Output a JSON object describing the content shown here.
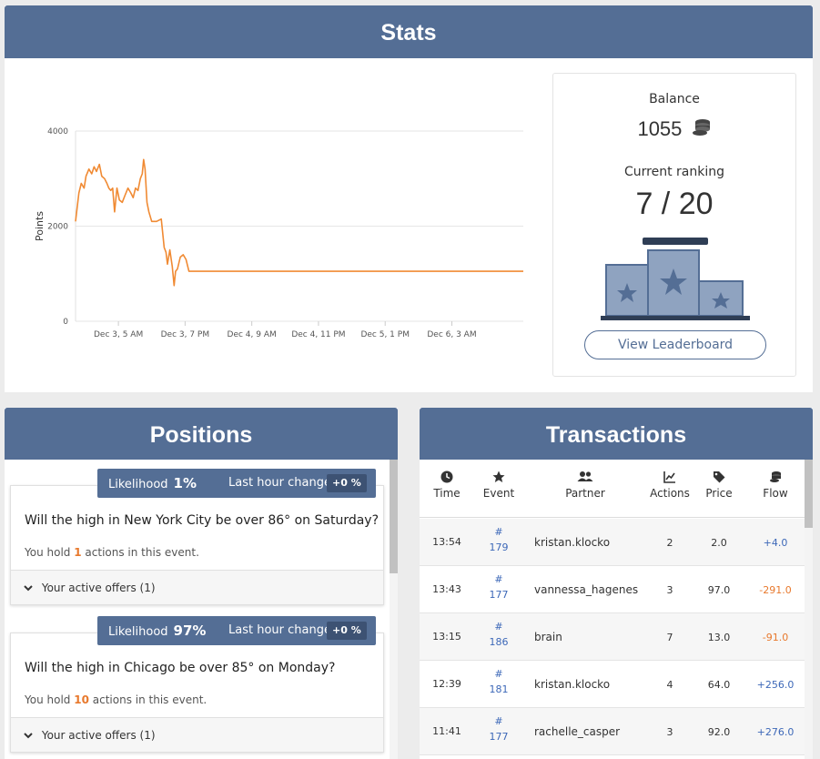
{
  "stats": {
    "title": "Stats",
    "balance_label": "Balance",
    "balance_value": "1055",
    "ranking_label": "Current ranking",
    "ranking_value": "7 / 20",
    "leaderboard_button": "View Leaderboard"
  },
  "chart_data": {
    "type": "line",
    "ylabel": "Points",
    "ylim": [
      0,
      4000
    ],
    "yticks": [
      "0",
      "2000",
      "4000"
    ],
    "xticks": [
      "Dec 3, 5 AM",
      "Dec 3, 7 PM",
      "Dec 4, 9 AM",
      "Dec 4, 11 PM",
      "Dec 5, 1 PM",
      "Dec 6, 3 AM"
    ],
    "xlim_hours": [
      -9,
      85
    ],
    "series": [
      {
        "color": "#f08a33",
        "x": [
          -9,
          -8.3,
          -7.8,
          -7.2,
          -6.8,
          -6.2,
          -5.6,
          -5.1,
          -4.6,
          -4.0,
          -3.5,
          -2.9,
          -2.4,
          -2.0,
          -1.6,
          -1.2,
          -0.8,
          -0.3,
          0.2,
          0.8,
          1.4,
          2.0,
          2.6,
          3.1,
          3.6,
          4.1,
          4.6,
          5.0,
          5.3,
          5.6,
          6.0,
          6.4,
          7.0,
          8.0,
          9.0,
          9.6,
          10.0,
          10.3,
          10.8,
          11.3,
          11.7,
          12.0,
          12.4,
          13.0,
          13.6,
          14.2,
          14.8,
          85
        ],
        "y": [
          2100,
          2700,
          2900,
          2800,
          3050,
          3200,
          3100,
          3250,
          3150,
          3300,
          3050,
          3000,
          2900,
          2800,
          2750,
          2800,
          2300,
          2800,
          2550,
          2500,
          2650,
          2800,
          2700,
          2600,
          2800,
          2750,
          3000,
          3100,
          3400,
          3200,
          2500,
          2300,
          2100,
          2100,
          2150,
          1550,
          1450,
          1200,
          1500,
          1150,
          750,
          1050,
          1100,
          1350,
          1400,
          1300,
          1050,
          1050
        ]
      }
    ]
  },
  "positions": {
    "title": "Positions",
    "likelihood_label": "Likelihood",
    "last_hour_label": "Last hour change",
    "hold_prefix": "You hold",
    "hold_suffix": "actions in this event.",
    "items": [
      {
        "likelihood": "1%",
        "change": "+0 %",
        "question": "Will the high in New York City be over 86° on Saturday?",
        "held": "1",
        "offers": "Your active offers (1)"
      },
      {
        "likelihood": "97%",
        "change": "+0 %",
        "question": "Will the high in Chicago be over 85° on Monday?",
        "held": "10",
        "offers": "Your active offers (1)"
      }
    ]
  },
  "transactions": {
    "title": "Transactions",
    "headers": {
      "time": "Time",
      "event": "Event",
      "partner": "Partner",
      "actions": "Actions",
      "price": "Price",
      "flow": "Flow"
    },
    "rows": [
      {
        "time": "13:54",
        "event_hash": "#",
        "event_id": "179",
        "partner": "kristan.klocko",
        "actions": "2",
        "price": "2.0",
        "flow": "+4.0",
        "flow_sign": "pos"
      },
      {
        "time": "13:43",
        "event_hash": "#",
        "event_id": "177",
        "partner": "vannessa_hagenes",
        "actions": "3",
        "price": "97.0",
        "flow": "-291.0",
        "flow_sign": "neg"
      },
      {
        "time": "13:15",
        "event_hash": "#",
        "event_id": "186",
        "partner": "brain",
        "actions": "7",
        "price": "13.0",
        "flow": "-91.0",
        "flow_sign": "neg"
      },
      {
        "time": "12:39",
        "event_hash": "#",
        "event_id": "181",
        "partner": "kristan.klocko",
        "actions": "4",
        "price": "64.0",
        "flow": "+256.0",
        "flow_sign": "pos"
      },
      {
        "time": "11:41",
        "event_hash": "#",
        "event_id": "177",
        "partner": "rachelle_casper",
        "actions": "3",
        "price": "92.0",
        "flow": "+276.0",
        "flow_sign": "pos"
      }
    ]
  },
  "colors": {
    "header": "#546e95",
    "line": "#f08a33",
    "positive": "#3d68b8",
    "negative": "#e8792d"
  },
  "icons": {
    "balance": "coins-icon",
    "ranking": "podium-icon",
    "time": "clock-icon",
    "event": "star-icon",
    "partner": "users-icon",
    "actions": "chart-icon",
    "price": "tag-icon",
    "flow": "coins-icon",
    "offers": "chevron-down-icon"
  }
}
